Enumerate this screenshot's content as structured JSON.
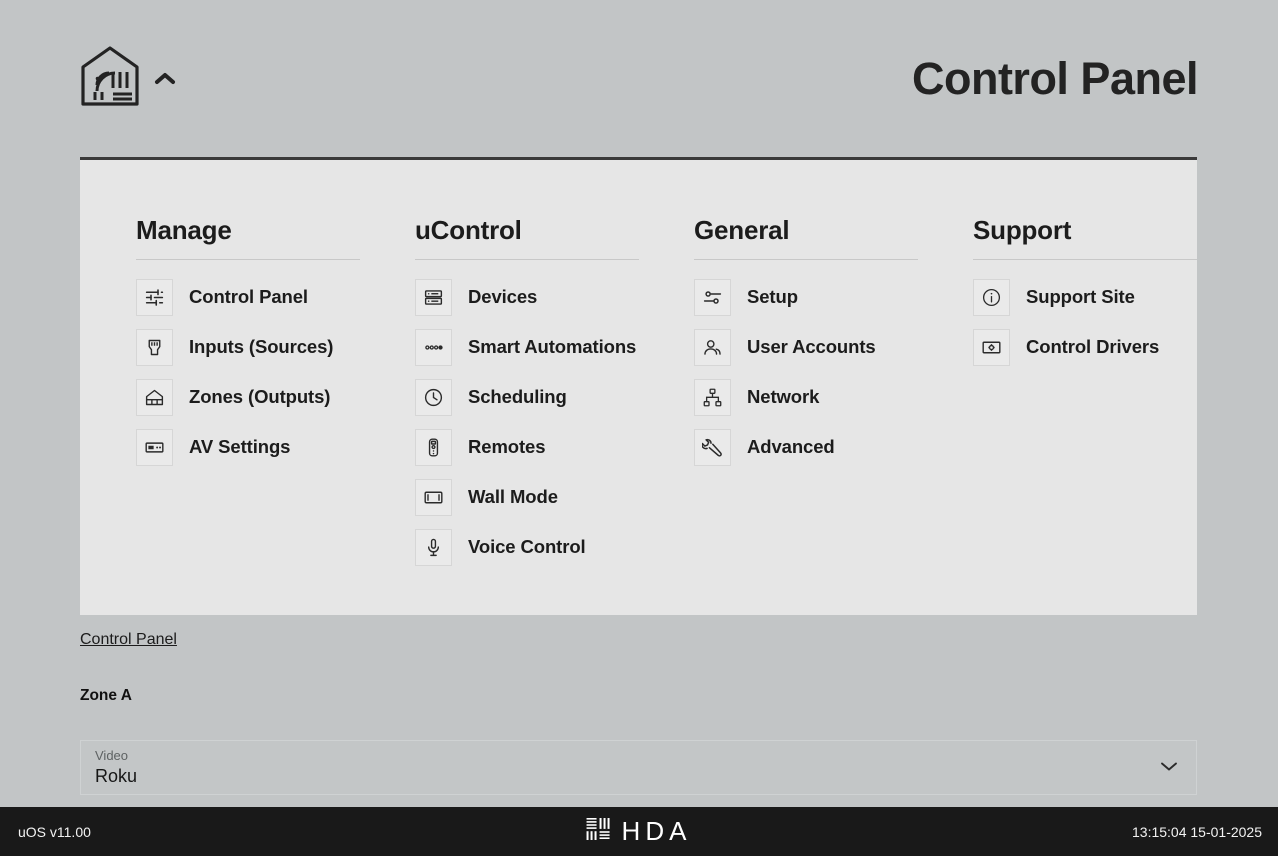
{
  "header": {
    "title": "Control Panel",
    "logo_icon": "home-network-logo",
    "collapse_icon": "chevron-up-icon"
  },
  "menu": {
    "columns": [
      {
        "title": "Manage",
        "items": [
          {
            "label": "Control Panel",
            "icon": "sliders-icon"
          },
          {
            "label": "Inputs (Sources)",
            "icon": "hdmi-connector-icon"
          },
          {
            "label": "Zones (Outputs)",
            "icon": "house-zone-icon"
          },
          {
            "label": "AV Settings",
            "icon": "av-receiver-icon"
          }
        ]
      },
      {
        "title": "uControl",
        "items": [
          {
            "label": "Devices",
            "icon": "server-rack-icon"
          },
          {
            "label": "Smart Automations",
            "icon": "dots-sequence-icon"
          },
          {
            "label": "Scheduling",
            "icon": "clock-icon"
          },
          {
            "label": "Remotes",
            "icon": "remote-control-icon"
          },
          {
            "label": "Wall Mode",
            "icon": "wall-display-icon"
          },
          {
            "label": "Voice Control",
            "icon": "microphone-icon"
          }
        ]
      },
      {
        "title": "General",
        "items": [
          {
            "label": "Setup",
            "icon": "settings-toggles-icon"
          },
          {
            "label": "User Accounts",
            "icon": "user-accounts-icon"
          },
          {
            "label": "Network",
            "icon": "network-topology-icon"
          },
          {
            "label": "Advanced",
            "icon": "wrench-icon"
          }
        ]
      },
      {
        "title": "Support",
        "items": [
          {
            "label": "Support Site",
            "icon": "info-circle-icon"
          },
          {
            "label": "Control Drivers",
            "icon": "driver-chip-icon"
          }
        ]
      }
    ]
  },
  "breadcrumb": {
    "label": "Control Panel"
  },
  "zone": {
    "name": "Zone A",
    "source_select": {
      "caption": "Video",
      "value": "Roku",
      "caret_icon": "chevron-down-icon"
    }
  },
  "footer": {
    "version": "uOS v11.00",
    "brand": "HDA",
    "brand_icon": "hda-bars-logo",
    "datetime": "13:15:04 15-01-2025"
  },
  "colors": {
    "page_background": "#c2c5c6",
    "panel_background": "#e6e6e6",
    "panel_top_border": "#3a3a3a",
    "footer_background": "#191919",
    "text_primary": "#1c1c1c"
  }
}
